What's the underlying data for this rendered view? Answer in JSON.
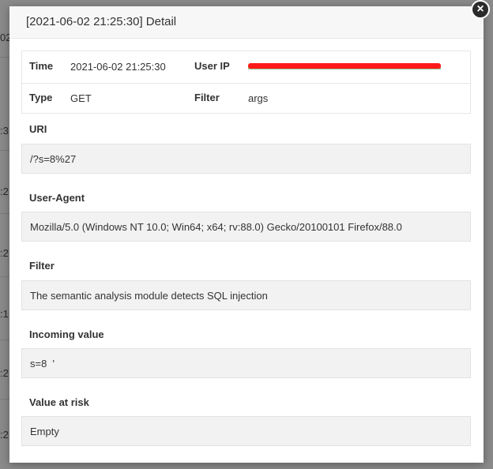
{
  "background": {
    "rows": [
      "02",
      ":3",
      ":2",
      ":2",
      ":1",
      ":2",
      ":2"
    ]
  },
  "modal": {
    "title": "[2021-06-02 21:25:30] Detail",
    "close_label": "×",
    "info": {
      "time_label": "Time",
      "time_value": "2021-06-02 21:25:30",
      "user_ip_label": "User IP",
      "user_ip_value": "",
      "type_label": "Type",
      "type_value": "GET",
      "filter_label": "Filter",
      "filter_value": "args"
    },
    "sections": [
      {
        "label": "URI",
        "value": "/?s=8%27"
      },
      {
        "label": "User-Agent",
        "value": "Mozilla/5.0 (Windows NT 10.0; Win64; x64; rv:88.0) Gecko/20100101 Firefox/88.0"
      },
      {
        "label": "Filter",
        "value": "The semantic analysis module detects SQL injection"
      },
      {
        "label": "Incoming value",
        "value": "s=8  '"
      },
      {
        "label": "Value at risk",
        "value": "Empty"
      }
    ]
  },
  "colors": {
    "redaction": "#ff1a1a",
    "close_button": "#2b2b2b",
    "value_box": "#f2f2f2"
  }
}
